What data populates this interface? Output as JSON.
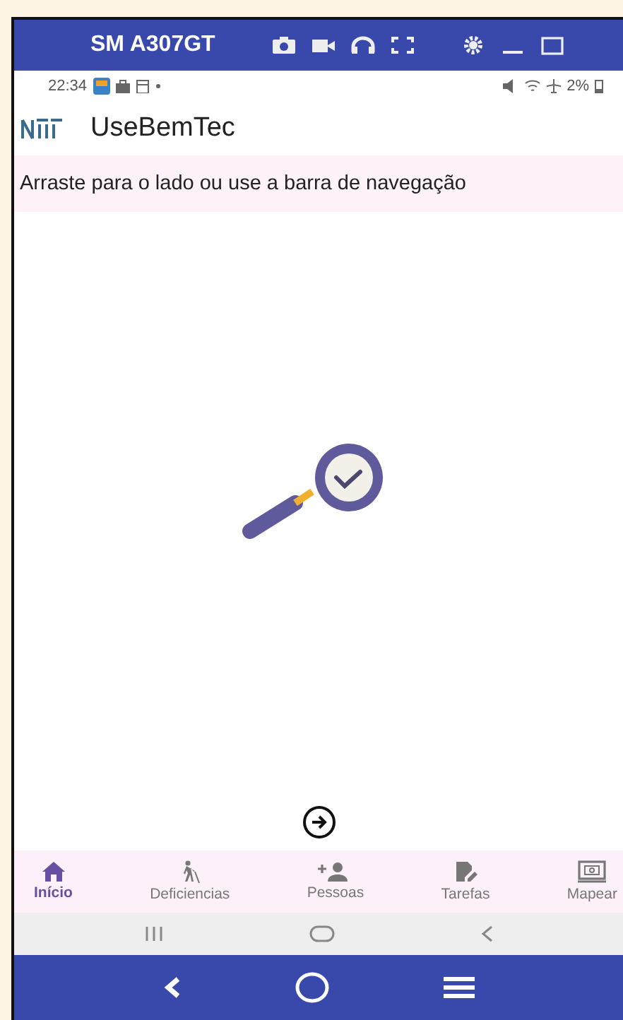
{
  "window": {
    "title": "SM A307GT"
  },
  "status_bar": {
    "time": "22:34",
    "battery": "2%"
  },
  "app_bar": {
    "title": "UseBemTec"
  },
  "hint": "Arraste para o lado ou use a barra de navegação",
  "bottom_nav": [
    {
      "label": "Início",
      "kind": "home",
      "selected": true
    },
    {
      "label": "Deficiencias",
      "kind": "walker",
      "selected": false
    },
    {
      "label": "Pessoas",
      "kind": "person-add",
      "selected": false
    },
    {
      "label": "Tarefas",
      "kind": "edit",
      "selected": false
    },
    {
      "label": "Mapear",
      "kind": "screen",
      "selected": false
    }
  ]
}
